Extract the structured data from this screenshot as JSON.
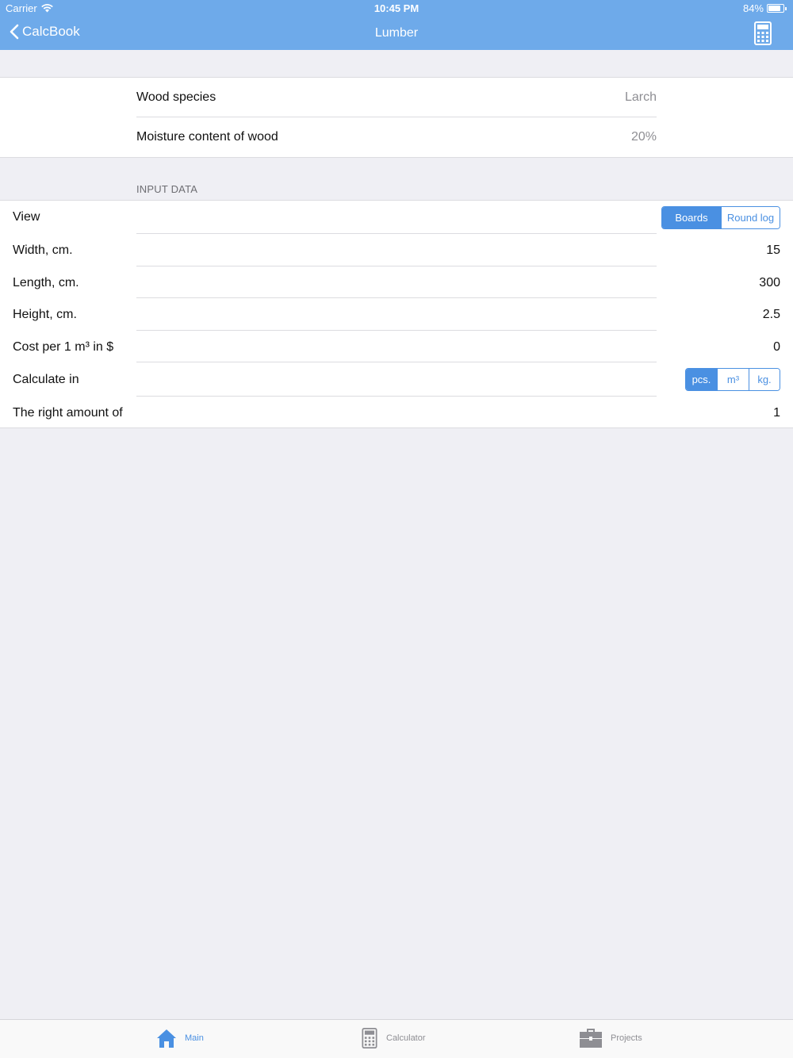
{
  "status": {
    "carrier": "Carrier",
    "time": "10:45 PM",
    "battery": "84%",
    "battery_level": 0.84
  },
  "nav": {
    "back_label": "CalcBook",
    "title": "Lumber"
  },
  "wood": {
    "species_label": "Wood species",
    "species_value": "Larch",
    "moisture_label": "Moisture content of wood",
    "moisture_value": "20%"
  },
  "input": {
    "section_title": "INPUT DATA",
    "view_label": "View",
    "view_options": [
      "Boards",
      "Round log"
    ],
    "width_label": "Width, cm.",
    "width_value": "15",
    "length_label": "Length, cm.",
    "length_value": "300",
    "height_label": "Height, cm.",
    "height_value": "2.5",
    "cost_label": "Cost per 1 m³ in $",
    "cost_value": "0",
    "calc_label": "Calculate in",
    "calc_options": [
      "pcs.",
      "m³",
      "kg."
    ],
    "amount_label": "The right amount of",
    "amount_value": "1"
  },
  "tabs": [
    "Main",
    "Calculator",
    "Projects"
  ],
  "colors": {
    "header": "#6eaaea",
    "accent": "#4a90e2",
    "background": "#efeff4"
  }
}
